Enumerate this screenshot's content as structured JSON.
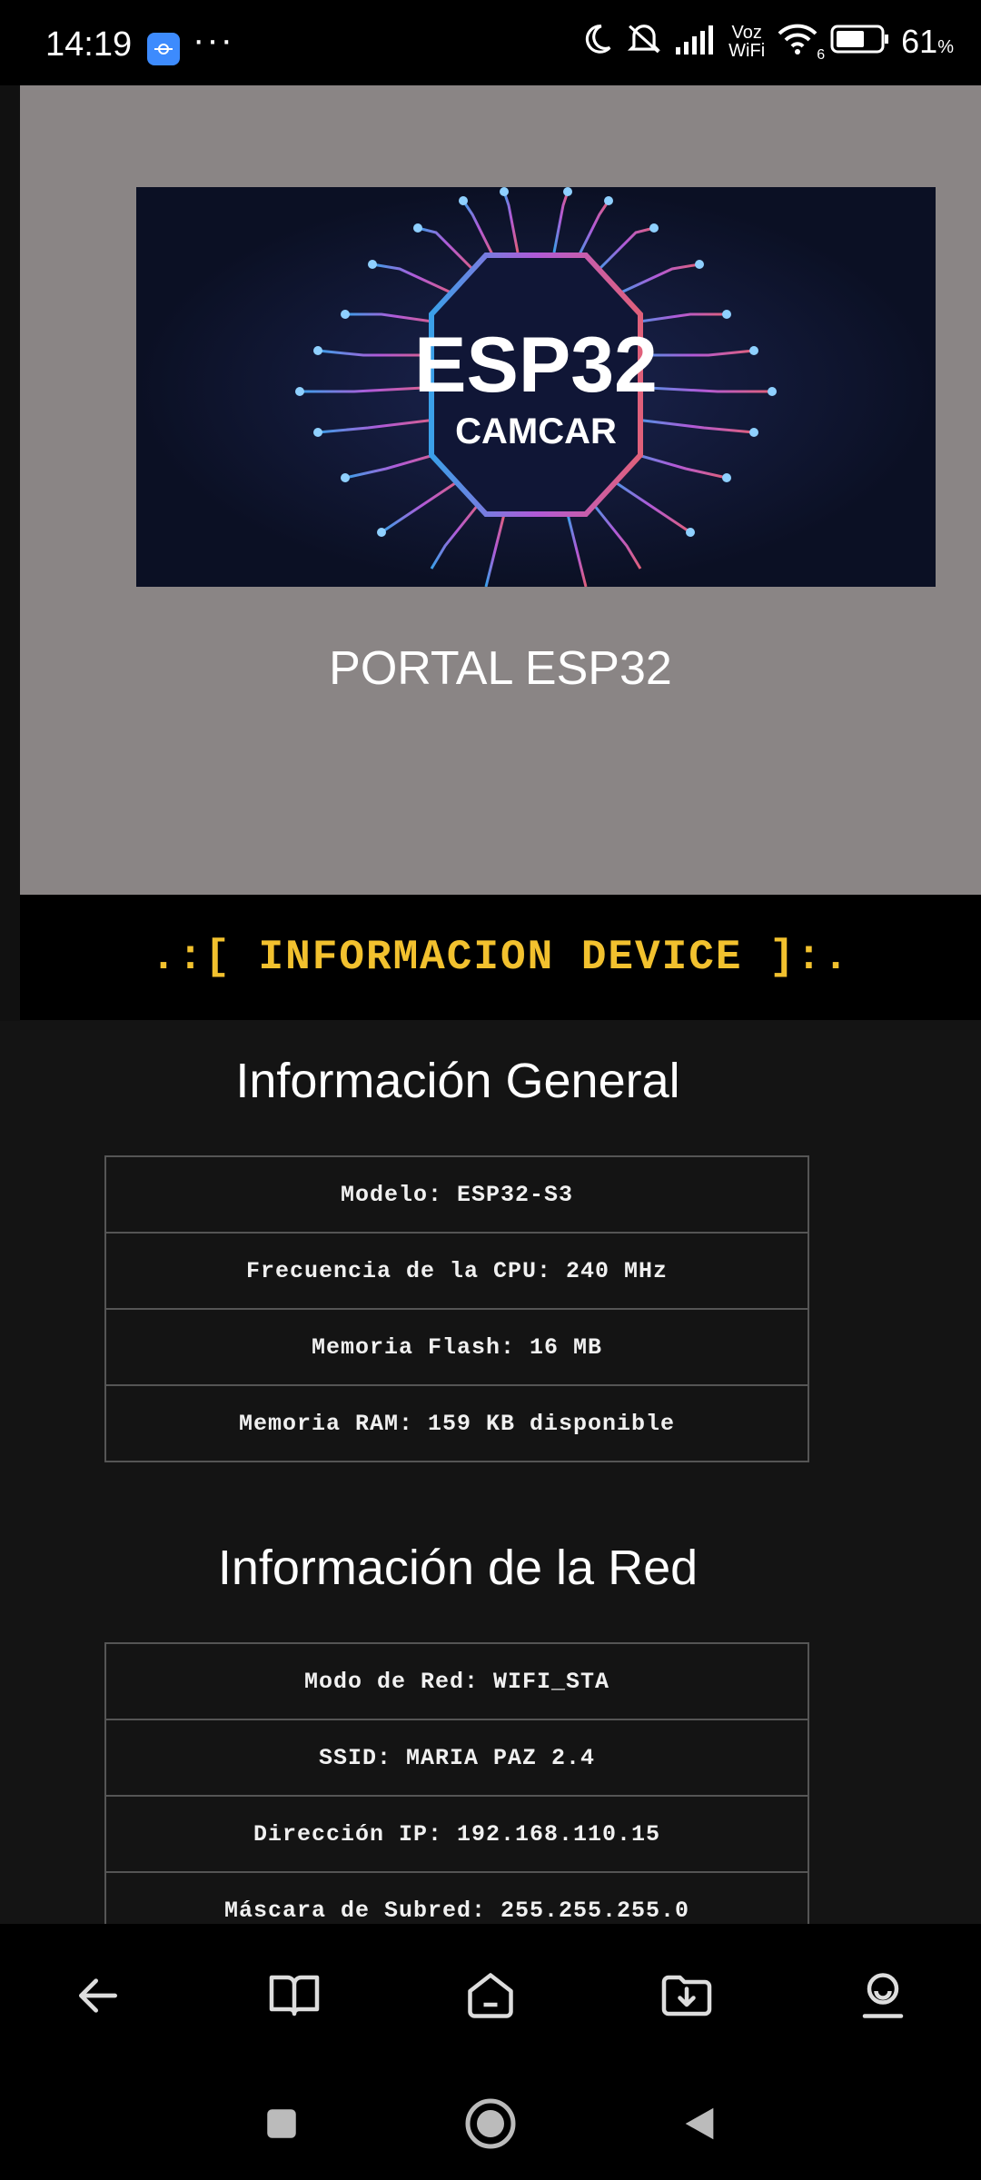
{
  "status_bar": {
    "time": "14:19",
    "more": "···",
    "network_label_top": "Voz",
    "network_label_bottom": "WiFi",
    "wifi_sub": "6",
    "battery_percent": "61",
    "battery_unit": "%",
    "icons": [
      "app-icon",
      "moon-icon",
      "mute-icon",
      "signal-icon",
      "wifi-icon",
      "battery-icon"
    ]
  },
  "hero": {
    "banner_line1": "ESP32",
    "banner_line2": "CAMCAR",
    "title": "PORTAL ESP32"
  },
  "info_bar": {
    "text": ".:[ INFORMACION DEVICE ]:."
  },
  "general": {
    "title": "Información General",
    "rows": [
      "Modelo: ESP32-S3",
      "Frecuencia de la CPU: 240 MHz",
      "Memoria Flash: 16 MB",
      "Memoria RAM: 159 KB disponible"
    ]
  },
  "network": {
    "title": "Información de la Red",
    "rows": [
      "Modo de Red: WIFI_STA",
      "SSID: MARIA PAZ 2.4",
      "Dirección IP: 192.168.110.15",
      "Máscara de Subred: 255.255.255.0"
    ]
  },
  "toolbar": {
    "icons": [
      "back-arrow-icon",
      "book-icon",
      "home-icon",
      "download-folder-icon",
      "profile-icon"
    ]
  },
  "system_nav": {
    "icons": [
      "recents-icon",
      "home-circle-icon",
      "back-triangle-icon"
    ]
  },
  "colors": {
    "hero_bg": "#8a8585",
    "info_bar_text": "#f2c12e",
    "page_bg": "#141414"
  }
}
